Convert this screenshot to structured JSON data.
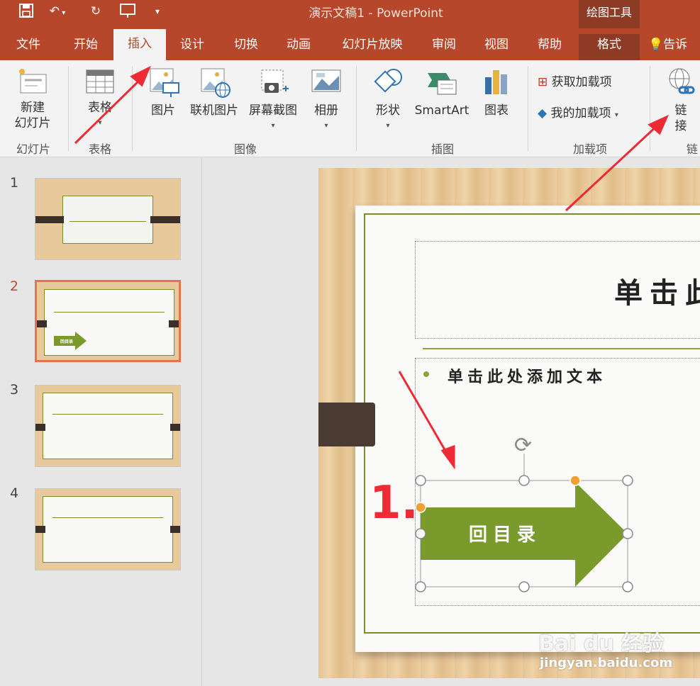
{
  "titlebar": {
    "doc_title": "演示文稿1  -  PowerPoint",
    "context_title": "绘图工具",
    "qat": {
      "save_icon": "save-icon",
      "undo_icon": "undo-icon",
      "redo_icon": "redo-icon",
      "present_icon": "present-icon",
      "customize_icon": "customize-icon"
    }
  },
  "tabs": [
    "文件",
    "开始",
    "插入",
    "设计",
    "切换",
    "动画",
    "幻灯片放映",
    "审阅",
    "视图",
    "帮助",
    "格式",
    "告诉"
  ],
  "active_tab": "插入",
  "ribbon": {
    "new_slide": "新建\n幻灯片",
    "table": "表格",
    "picture": "图片",
    "online_picture": "联机图片",
    "screenshot": "屏幕截图",
    "album": "相册",
    "shapes": "形状",
    "smartart": "SmartArt",
    "chart": "图表",
    "get_addins": "获取加载项",
    "my_addins": "我的加载项",
    "link": "链\n接",
    "groups": {
      "slides": "幻灯片",
      "tables": "表格",
      "images": "图像",
      "illustrations": "插图",
      "addins": "加载项",
      "links": "链"
    }
  },
  "thumbnails": [
    {
      "number": "1"
    },
    {
      "number": "2",
      "arrow_label": "回目录"
    },
    {
      "number": "3"
    },
    {
      "number": "4"
    }
  ],
  "slide": {
    "title_placeholder": "单击此",
    "body_placeholder": "单击此处添加文本",
    "arrow_label": "回目录",
    "annotation": "1."
  },
  "watermark": {
    "brand": "Bai du 经验",
    "url": "jingyan.baidu.com"
  },
  "colors": {
    "accent": "#b7472a",
    "context_tab": "#8e3b26",
    "arrow_fill": "#7a9a2c",
    "annotation_red": "#ee2b35"
  }
}
